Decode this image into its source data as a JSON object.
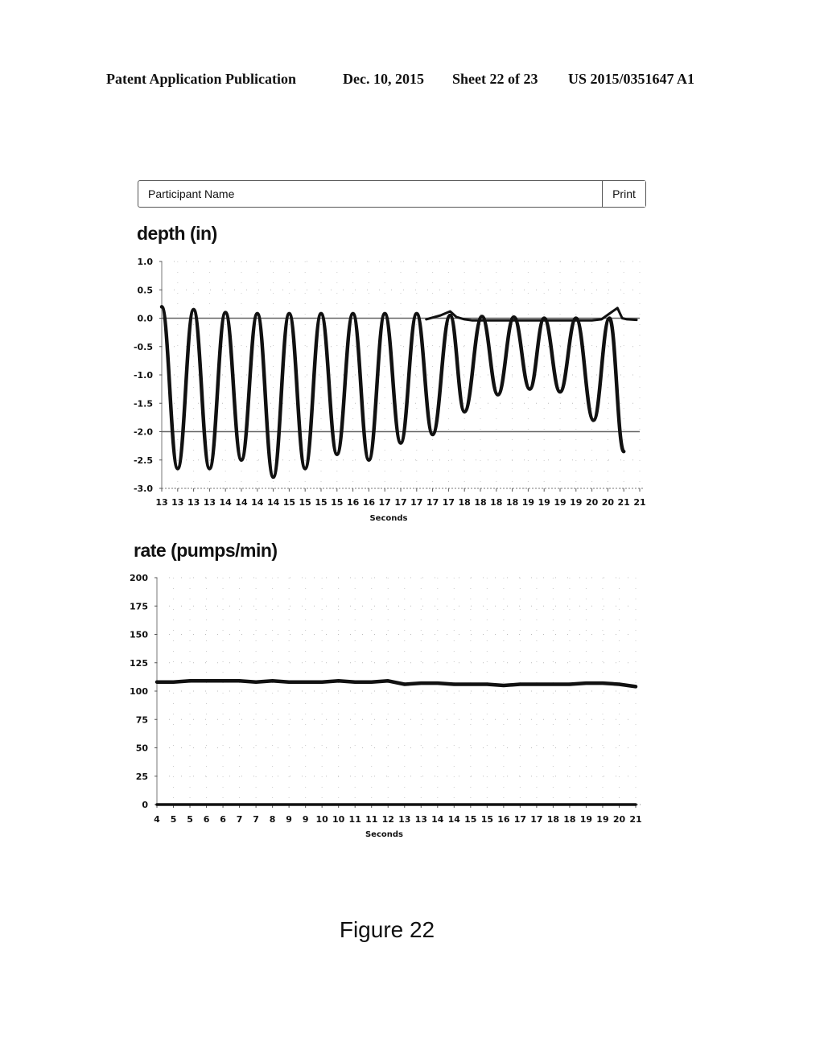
{
  "header": {
    "publication": "Patent Application Publication",
    "date": "Dec. 10, 2015",
    "sheet": "Sheet 22 of 23",
    "number": "US 2015/0351647 A1"
  },
  "toolbar": {
    "name_placeholder": "Participant Name",
    "name_value": "",
    "print_label": "Print"
  },
  "depth_section": {
    "title": "depth (in)"
  },
  "rate_section": {
    "title": "rate (pumps/min)"
  },
  "figure_caption": "Figure 22",
  "chart_data": [
    {
      "id": "depth",
      "type": "line",
      "title": "depth (in)",
      "xlabel": "Seconds",
      "ylabel": "",
      "ylim": [
        -3.0,
        1.0
      ],
      "yticks": [
        1.0,
        0.5,
        0.0,
        -0.5,
        -1.0,
        -1.5,
        -2.0,
        -2.5,
        -3.0
      ],
      "ytick_labels": [
        "1.0",
        "0.5",
        "0.0",
        "-0.5",
        "-1.0",
        "-1.5",
        "-2.0",
        "-2.5",
        "-3.0"
      ],
      "categories": [
        "13",
        "13",
        "13",
        "13",
        "14",
        "14",
        "14",
        "14",
        "15",
        "15",
        "15",
        "15",
        "16",
        "16",
        "17",
        "17",
        "17",
        "17",
        "17",
        "18",
        "18",
        "18",
        "18",
        "19",
        "19",
        "19",
        "19",
        "20",
        "20",
        "21",
        "21"
      ],
      "grid": true,
      "reference_lines": [
        0.0,
        -2.0
      ],
      "series": [
        {
          "name": "depth",
          "points": [
            [
              0.0,
              0.2
            ],
            [
              1.0,
              -2.65
            ],
            [
              2.0,
              0.15
            ],
            [
              3.0,
              -2.65
            ],
            [
              4.0,
              0.1
            ],
            [
              5.0,
              -2.5
            ],
            [
              6.0,
              0.08
            ],
            [
              7.0,
              -2.8
            ],
            [
              8.0,
              0.08
            ],
            [
              9.0,
              -2.65
            ],
            [
              10.0,
              0.08
            ],
            [
              11.0,
              -2.4
            ],
            [
              12.0,
              0.08
            ],
            [
              13.0,
              -2.5
            ],
            [
              14.0,
              0.08
            ],
            [
              15.0,
              -2.2
            ],
            [
              16.0,
              0.08
            ],
            [
              17.0,
              -2.05
            ],
            [
              18.1,
              0.05
            ],
            [
              19.0,
              -1.65
            ],
            [
              20.1,
              0.03
            ],
            [
              21.1,
              -1.35
            ],
            [
              22.1,
              0.02
            ],
            [
              23.1,
              -1.25
            ],
            [
              24.0,
              0.0
            ],
            [
              25.0,
              -1.3
            ],
            [
              26.0,
              0.0
            ],
            [
              27.1,
              -1.8
            ],
            [
              28.1,
              0.0
            ],
            [
              29.0,
              -2.35
            ]
          ]
        },
        {
          "name": "baseline-marker",
          "points": [
            [
              16.6,
              -0.02
            ],
            [
              17.5,
              0.05
            ],
            [
              18.1,
              0.12
            ],
            [
              18.5,
              0.02
            ],
            [
              19.0,
              -0.02
            ],
            [
              19.5,
              -0.04
            ],
            [
              20.5,
              -0.04
            ],
            [
              27.0,
              -0.04
            ],
            [
              27.6,
              -0.02
            ],
            [
              28.2,
              0.1
            ],
            [
              28.6,
              0.18
            ],
            [
              28.9,
              0.0
            ],
            [
              29.2,
              -0.02
            ],
            [
              29.8,
              -0.03
            ]
          ]
        }
      ]
    },
    {
      "id": "rate",
      "type": "line",
      "title": "rate (pumps/min)",
      "xlabel": "Seconds",
      "ylabel": "",
      "ylim": [
        0,
        200
      ],
      "yticks": [
        200,
        175,
        150,
        125,
        100,
        75,
        50,
        25,
        0
      ],
      "ytick_labels": [
        "200",
        "175",
        "150",
        "125",
        "100",
        "75",
        "50",
        "25",
        "0"
      ],
      "categories": [
        "4",
        "5",
        "5",
        "6",
        "6",
        "7",
        "7",
        "8",
        "9",
        "9",
        "10",
        "10",
        "11",
        "11",
        "12",
        "13",
        "13",
        "14",
        "14",
        "15",
        "15",
        "16",
        "17",
        "17",
        "18",
        "18",
        "19",
        "19",
        "20",
        "21"
      ],
      "grid": true,
      "series": [
        {
          "name": "rate",
          "values": [
            108,
            108,
            109,
            109,
            109,
            109,
            108,
            109,
            108,
            108,
            108,
            109,
            108,
            108,
            109,
            106,
            107,
            107,
            106,
            106,
            106,
            105,
            106,
            106,
            106,
            106,
            107,
            107,
            106,
            104
          ]
        },
        {
          "name": "zero-line",
          "values": [
            0,
            0,
            0,
            0,
            0,
            0,
            0,
            0,
            0,
            0,
            0,
            0,
            0,
            0,
            0,
            0,
            0,
            0,
            0,
            0,
            0,
            0,
            0,
            0,
            0,
            0,
            0,
            0,
            0,
            0
          ]
        }
      ]
    }
  ]
}
